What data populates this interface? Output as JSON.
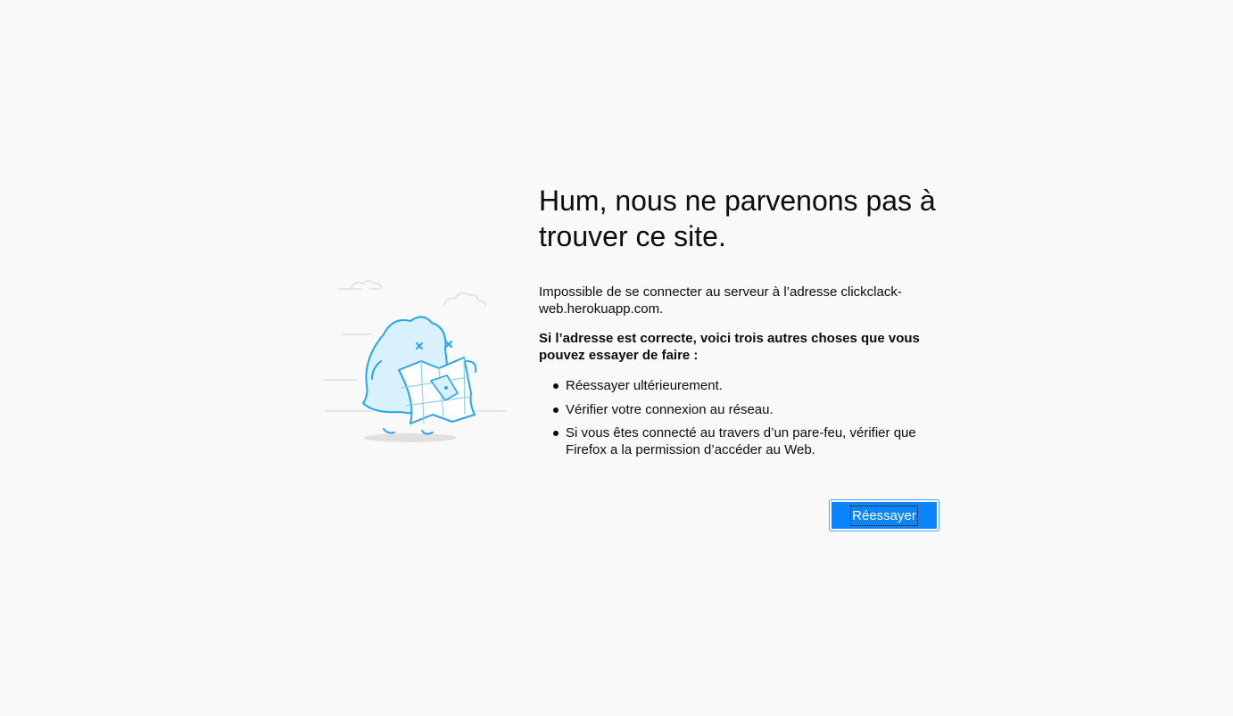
{
  "error_page": {
    "title": "Hum, nous ne parvenons pas à trouver ce site.",
    "description": "Impossible de se connecter au serveur à l’adresse clickclack-web.herokuapp.com.",
    "subheading": "Si l’adresse est correcte, voici trois autres choses que vous pouvez essayer de faire :",
    "suggestions": [
      "Réessayer ultérieurement.",
      "Vérifier votre connexion au réseau.",
      "Si vous êtes connecté au travers d’un pare-feu, vérifier que Firefox a la permission d’accéder au Web."
    ],
    "retry_label": "Réessayer"
  },
  "illustration": {
    "icon": "lost-map-creature-icon"
  },
  "colors": {
    "background": "#f9f9fa",
    "accent": "#0a84ff",
    "illustration_stroke": "#2aa4e8",
    "illustration_fill": "#d9f1fd"
  }
}
